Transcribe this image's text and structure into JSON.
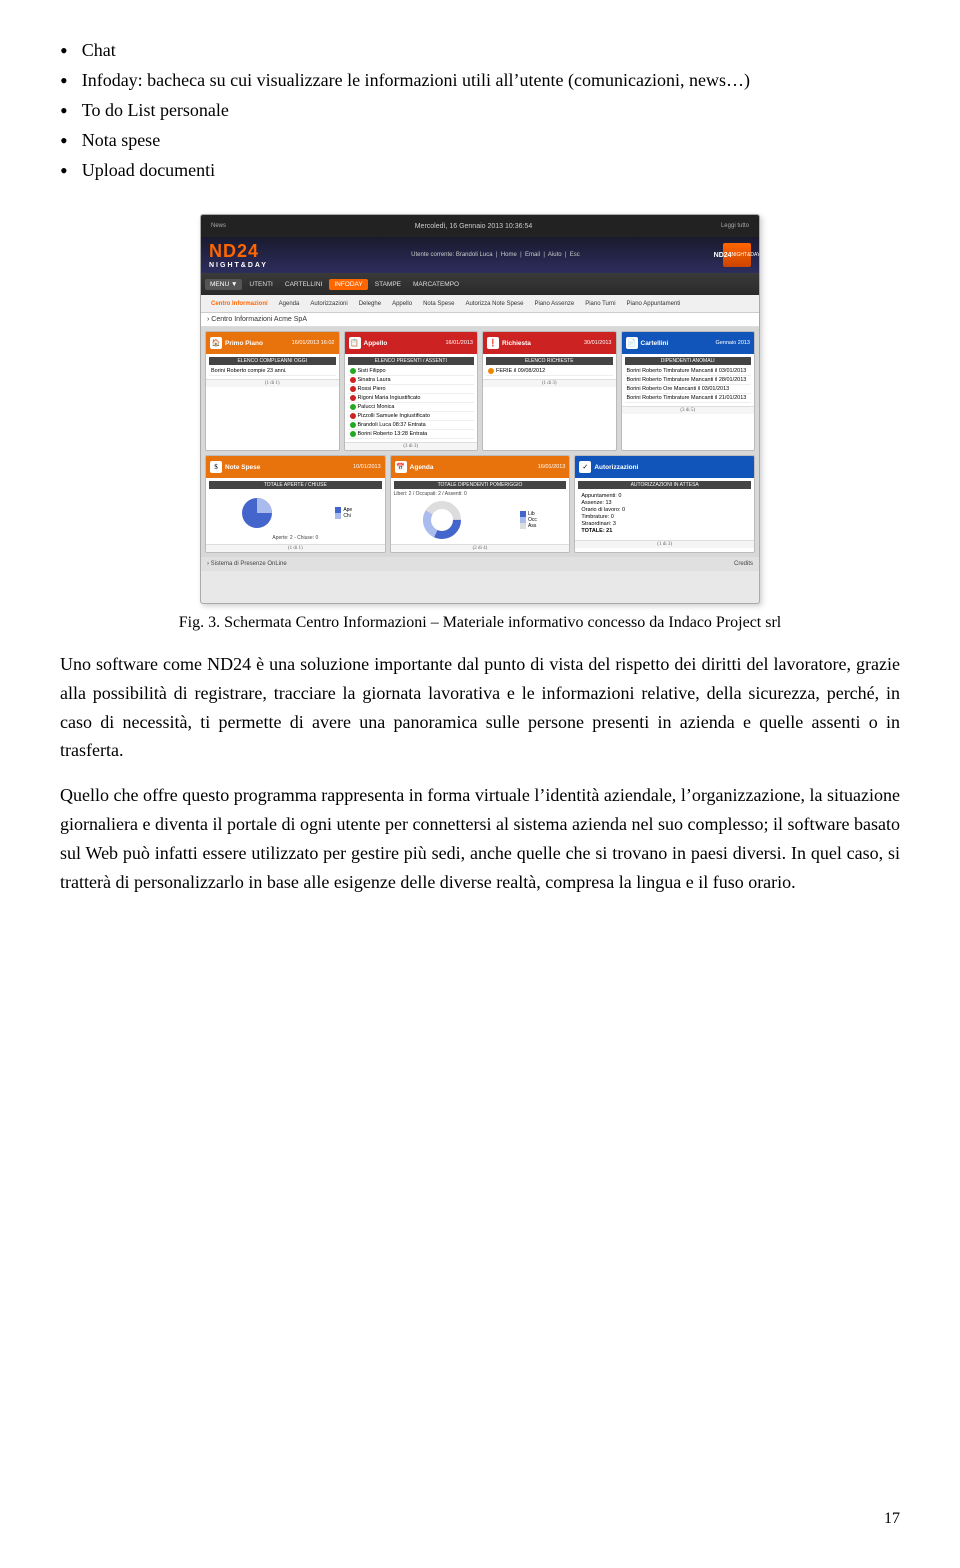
{
  "bullets": [
    {
      "text": "Chat"
    },
    {
      "text": "Infoday: bacheca su cui visualizzare le informazioni utili all’utente (comunicazioni, news…)"
    },
    {
      "text": "To do List personale"
    },
    {
      "text": "Nota spese"
    },
    {
      "text": "Upload documenti"
    }
  ],
  "figure": {
    "caption": "Fig. 3. Schermata Centro Informazioni – Materiale informativo concesso da Indaco  Project srl",
    "nd24": {
      "topbar": "Mercoledì, 16 Gennaio 2013 10:36:54",
      "user": "Utente corrente: Brandoli Luca",
      "logo": "ND24",
      "logoSub": "NIGHT&DAY",
      "navItems": [
        "MENU",
        "UTENTI",
        "CARTELLINI",
        "INFODAY",
        "STAMPE",
        "MARCATEMPO"
      ],
      "activeNav": "INFODAY",
      "subNavItems": [
        "Centro Informazioni",
        "Agenda",
        "Autorizzazioni",
        "Deleghe",
        "Appello",
        "Nota Spese",
        "Autorizza Note Spese",
        "Piano Assenze",
        "Piano Turni",
        "Piano Appuntamenti"
      ],
      "contentHeader": "› Centro Informazioni Acme SpA",
      "widgets": [
        {
          "title": "Primo Piano",
          "date": "16/01/2013 16:02",
          "color": "orange",
          "label": "ELENCO COMPLEANNI OGGI",
          "items": [
            "Borini Roberto compie 23 anni."
          ],
          "footer": "(1 di 1)"
        },
        {
          "title": "Appello",
          "date": "16/01/2013",
          "color": "red",
          "label": "ELENCO PRESENTI / ASSENTI",
          "items": [
            {
              "dot": "green",
              "text": "Sisti Filippo"
            },
            {
              "dot": "red",
              "text": "Sinatra Laura"
            },
            {
              "dot": "red",
              "text": "Rossi Piero"
            },
            {
              "dot": "red",
              "text": "Rigoni Maria Ingiustificato"
            },
            {
              "dot": "green",
              "text": "Palucci Monica"
            },
            {
              "dot": "red",
              "text": "Pizzolli Samuele Ingiustificato"
            },
            {
              "dot": "green",
              "text": "Brandoli Luca 08:37 Entrata"
            },
            {
              "dot": "green",
              "text": "Borini Roberto 13:28 Entrata"
            }
          ],
          "footer": "(3 di 3)"
        },
        {
          "title": "Richiesta",
          "date": "30/01/2013",
          "color": "red",
          "label": "ELENCO RICHIESTE",
          "items": [
            {
              "dot": "orange",
              "text": "FERIE il 09/08/2012"
            }
          ],
          "footer": "(1 di 3)"
        },
        {
          "title": "Cartellini",
          "date": "Gennaio 2013",
          "color": "blue",
          "label": "DIPENDENTI ANOMALI",
          "items": [
            "Borini Roberto Timbrature Mancanti il 03/01/2013",
            "Borini Roberto Timbrature Mancanti il 28/01/2013",
            "Borini Roberto Ore Mancanti il 03/01/2013",
            "Borini Roberto Timbrature Mancanti il 21/01/2013"
          ],
          "footer": "(3 di 5)"
        }
      ],
      "widgets2": [
        {
          "title": "Note Spese",
          "date": "10/01/2013",
          "color": "orange",
          "label": "TOTALE APERTE / CHIUSE",
          "hasChart": true,
          "chartType": "pie",
          "legend": [
            "Ape",
            "Chi"
          ],
          "footer": "(1 di 1)"
        },
        {
          "title": "Agenda",
          "date": "16/01/2013",
          "color": "orange",
          "label": "TOTALE DIPENDENTI POMERIGGIO",
          "stats": "Liberi: 2 / Occupati: 2 / Assenti: 0",
          "hasChart": true,
          "chartType": "donut",
          "legend": [
            "Lib",
            "Occ",
            "Ass"
          ],
          "footer": "(2 di 4)"
        },
        {
          "title": "Autorizzazioni",
          "date": "",
          "color": "blue",
          "label": "AUTORIZZAZIONI IN ATTESA",
          "stats": [
            "Appuntamenti: 0",
            "Assenze: 13",
            "Orario di lavoro: 0",
            "Timbrature: 0",
            "Straordinari: 3",
            "TOTALE: 21"
          ],
          "footer": "(1 di 3)"
        }
      ],
      "bottomBar": "› Sistema di Presenze OnLine",
      "credits": "Credits"
    }
  },
  "paragraphs": [
    "Uno software come ND24 è una soluzione importante dal punto di vista del rispetto dei diritti del lavoratore, grazie alla possibilità di registrare, tracciare la giornata lavorativa e le informazioni relative, della sicurezza, perché, in caso di necessità, ti permette di avere una panoramica sulle persone presenti in azienda e quelle assenti o in trasferta.",
    "Quello che offre questo programma rappresenta in forma virtuale l’identità aziendale, l’organizzazione, la situazione giornaliera e diventa il portale di ogni utente per connettersi al sistema azienda nel suo complesso; il software basato sul Web può infatti essere utilizzato per gestire più sedi, anche quelle che si trovano in paesi diversi. In quel caso, si tratterà di personalizzarlo in base alle esigenze delle diverse realtà, compresa la lingua e il fuso orario."
  ],
  "pageNumber": "17"
}
